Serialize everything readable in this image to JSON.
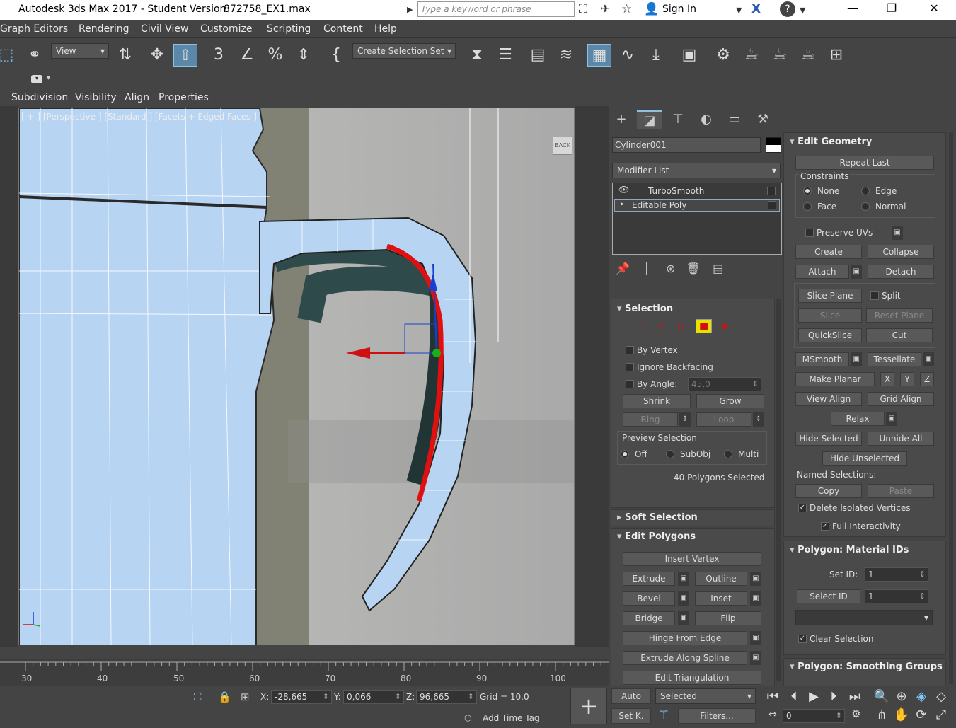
{
  "titlebar": {
    "app_title": "Autodesk 3ds Max 2017 - Student Version",
    "file_name": "872758_EX1.max",
    "search_placeholder": "Type a keyword or phrase",
    "sign_in": "Sign In"
  },
  "menu": [
    "Graph Editors",
    "Rendering",
    "Civil View",
    "Customize",
    "Scripting",
    "Content",
    "Help"
  ],
  "toolbar": {
    "view_dropdown": "View",
    "selection_set": "Create Selection Set"
  },
  "ribbon_tabs": [
    "Subdivision",
    "Visibility",
    "Align",
    "Properties"
  ],
  "viewport": {
    "label": "[ + ] [Perspective ] [Standard ] [Facets + Edged Faces ]",
    "viewcube": "BACK",
    "axis_z": "z"
  },
  "command_panel": {
    "object_name": "Cylinder001",
    "modifier_list": "Modifier List",
    "stack": [
      "TurboSmooth",
      "Editable Poly"
    ],
    "selection": {
      "title": "Selection",
      "by_vertex": "By Vertex",
      "ignore_backfacing": "Ignore Backfacing",
      "by_angle": "By Angle:",
      "angle_value": "45,0",
      "shrink": "Shrink",
      "grow": "Grow",
      "ring": "Ring",
      "loop": "Loop",
      "preview_title": "Preview Selection",
      "preview_off": "Off",
      "preview_subobj": "SubObj",
      "preview_multi": "Multi",
      "status": "40 Polygons Selected"
    },
    "soft_selection": "Soft Selection",
    "edit_polygons": {
      "title": "Edit Polygons",
      "insert_vertex": "Insert Vertex",
      "extrude": "Extrude",
      "outline": "Outline",
      "bevel": "Bevel",
      "inset": "Inset",
      "bridge": "Bridge",
      "flip": "Flip",
      "hinge": "Hinge From Edge",
      "extrude_spline": "Extrude Along Spline",
      "edit_tri": "Edit Triangulation"
    },
    "edit_geometry": {
      "title": "Edit Geometry",
      "repeat_last": "Repeat Last",
      "constraints": "Constraints",
      "none": "None",
      "edge": "Edge",
      "face": "Face",
      "normal": "Normal",
      "preserve_uvs": "Preserve UVs",
      "create": "Create",
      "collapse": "Collapse",
      "attach": "Attach",
      "detach": "Detach",
      "slice_plane": "Slice Plane",
      "split": "Split",
      "slice": "Slice",
      "reset_plane": "Reset Plane",
      "quickslice": "QuickSlice",
      "cut": "Cut",
      "msmooth": "MSmooth",
      "tessellate": "Tessellate",
      "make_planar": "Make Planar",
      "x": "X",
      "y": "Y",
      "z": "Z",
      "view_align": "View Align",
      "grid_align": "Grid Align",
      "relax": "Relax",
      "hide_selected": "Hide Selected",
      "unhide_all": "Unhide All",
      "hide_unselected": "Hide Unselected",
      "named_selections": "Named Selections:",
      "copy": "Copy",
      "paste": "Paste",
      "delete_isolated": "Delete Isolated Vertices",
      "full_interactivity": "Full Interactivity"
    },
    "material_ids": {
      "title": "Polygon: Material IDs",
      "set_id": "Set ID:",
      "set_id_value": "1",
      "select_id": "Select ID",
      "select_id_value": "1",
      "clear_selection": "Clear Selection"
    },
    "smoothing_groups": "Polygon: Smoothing Groups"
  },
  "timeline": {
    "ticks": [
      "30",
      "40",
      "50",
      "60",
      "70",
      "80",
      "90",
      "100"
    ]
  },
  "status": {
    "x_label": "X:",
    "x_value": "-28,665",
    "y_label": "Y:",
    "y_value": "0,066",
    "z_label": "Z:",
    "z_value": "96,665",
    "grid": "Grid = 10,0",
    "add_time_tag": "Add Time Tag",
    "auto": "Auto",
    "set_key": "Set K.",
    "selected": "Selected",
    "filters": "Filters...",
    "frame": "0"
  }
}
